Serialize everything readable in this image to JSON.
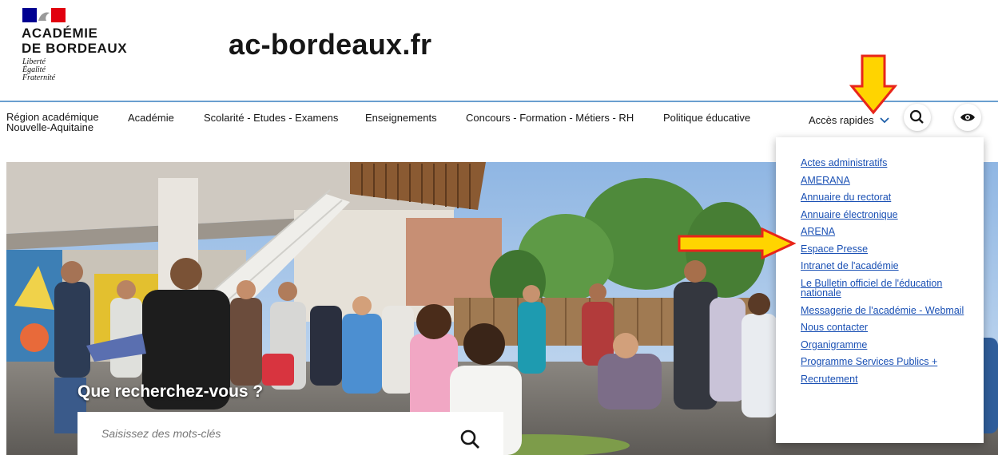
{
  "header": {
    "institution_line1": "ACADÉMIE",
    "institution_line2": "DE BORDEAUX",
    "motto": [
      "Liberté",
      "Égalité",
      "Fraternité"
    ],
    "site_name": "ac-bordeaux.fr"
  },
  "nav": {
    "region_line1": "Région académique",
    "region_line2": "Nouvelle-Aquitaine",
    "items": [
      "Académie",
      "Scolarité - Etudes - Examens",
      "Enseignements",
      "Concours - Formation - Métiers - RH",
      "Politique éducative"
    ],
    "quick_access": "Accès rapides",
    "search_icon": "search-icon",
    "accessibility_icon": "eye-icon"
  },
  "dropdown": {
    "items": [
      "Actes administratifs",
      "AMERANA",
      "Annuaire du rectorat",
      "Annuaire électronique",
      "ARENA",
      "Espace Presse",
      "Intranet de l'académie",
      "Le Bulletin officiel de l'éducation nationale",
      "Messagerie de l'académie - Webmail",
      "Nous contacter",
      "Organigramme",
      "Programme Services Publics +",
      "Recrutement"
    ]
  },
  "hero": {
    "search_title": "Que recherchez-vous ?",
    "search_placeholder": "Saisissez des mots-clés"
  },
  "colors": {
    "link": "#1a50b4",
    "header_border": "#6a9fcf",
    "arrow_fill": "#ffd400",
    "arrow_stroke": "#e8251a",
    "flag_blue": "#000091",
    "flag_red": "#e1000f"
  }
}
